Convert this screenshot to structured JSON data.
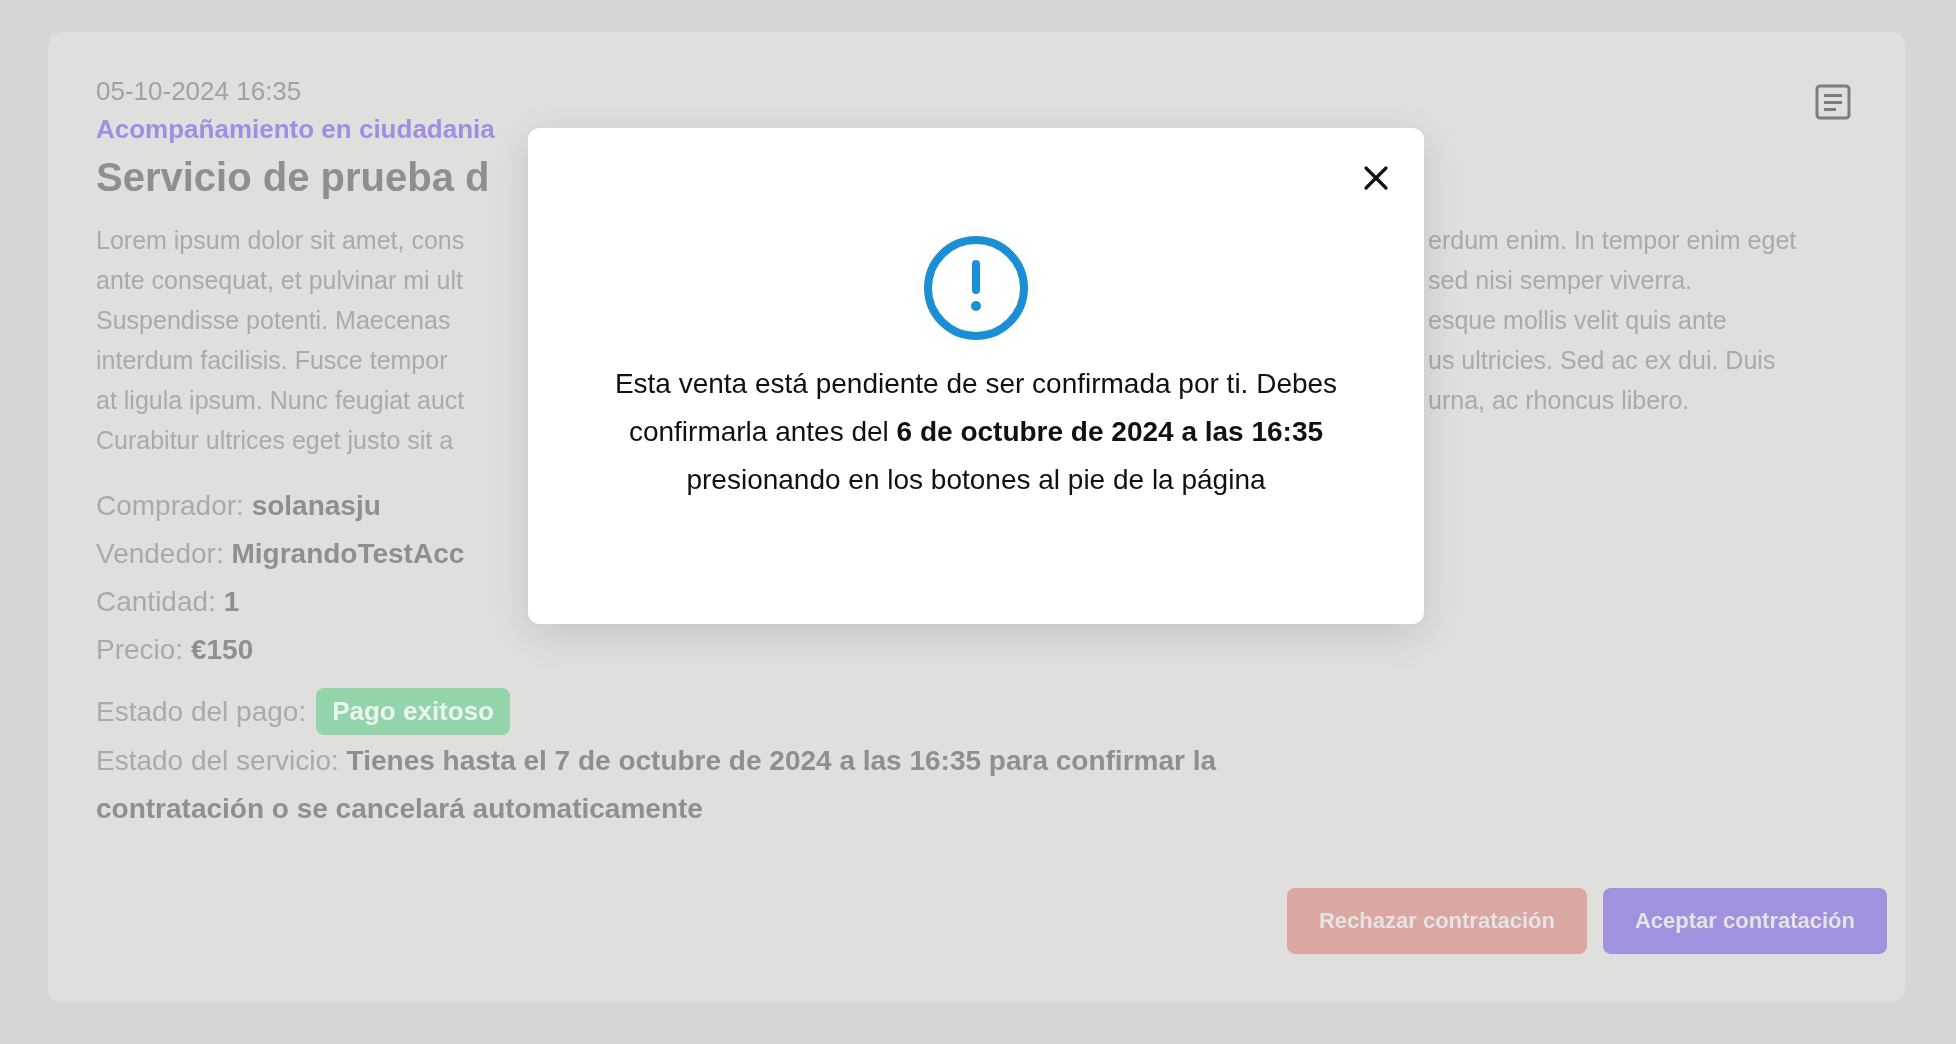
{
  "date": "05-10-2024 16:35",
  "category": "Acompañamiento en ciudadania",
  "title": "Servicio de prueba d",
  "description": [
    {
      "left": "Lorem ipsum dolor sit amet, cons",
      "right": "erdum enim. In tempor enim eget"
    },
    {
      "left": "ante consequat, et pulvinar mi ult",
      "right": "sed nisi semper viverra."
    },
    {
      "left": "Suspendisse potenti. Maecenas",
      "right": "esque mollis velit quis ante"
    },
    {
      "left": "interdum facilisis. Fusce tempor",
      "right": "us ultricies. Sed ac ex dui. Duis"
    },
    {
      "left": "at ligula ipsum. Nunc feugiat auct",
      "right": "urna, ac rhoncus libero."
    },
    {
      "left": "Curabitur ultrices eget justo sit a"
    }
  ],
  "details": [
    "Comprador: **solanasju**",
    "Vendedor: **MigrandoTestAcc**",
    "Cantidad: **1**",
    "Precio: **€150**"
  ],
  "payment_status": {
    "label": "Estado del pago:",
    "badge": "Pago exitoso"
  },
  "service_status": "Estado del servicio: **Tienes hasta el 7 de octubre de 2024 a las 16:35 para confirmar la contratación o se cancelará automaticamente**",
  "buttons": [
    {
      "label": "Rechazar contratación",
      "kind": "reject"
    },
    {
      "label": "Aceptar contratación",
      "kind": "accept"
    }
  ],
  "modal": {
    "message": "Esta venta está pendiente de ser confirmada por ti. Debes confirmarla antes del **6 de octubre de 2024 a las 16:35** presionando en los botones al pie de la página"
  }
}
